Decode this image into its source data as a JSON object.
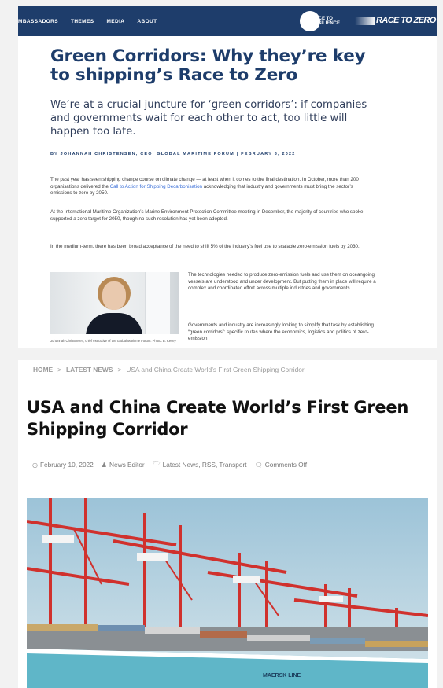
{
  "top_article": {
    "nav": {
      "items": [
        "MBASSADORS",
        "THEMES",
        "MEDIA",
        "ABOUT"
      ],
      "logo_left": {
        "line1": "RACE TO",
        "line2": "RESILIENCE"
      },
      "logo_right": "RACE TO ZERO"
    },
    "title": "Green Corridors: Why they’re key to shipping’s Race to Zero",
    "subtitle": "We’re at a crucial juncture for ‘green corridors’: if companies and governments wait for each other to act, too little will happen too late.",
    "byline": "BY JOHANNAH CHRISTENSEN, CEO, GLOBAL MARITIME FORUM | FEBRUARY 3, 2022",
    "para1": {
      "before": "The past year has seen shipping change course on climate change — at least when it comes to the final destination. In October, more than 200 organisations delivered the ",
      "link": "Call to Action for Shipping Decarbonisation",
      "after": " acknowledging that industry and governments must bring the sector’s emissions to zero by 2050."
    },
    "para2": "At the International Maritime Organization’s Marine Environment Protection Committee meeting in December, the majority of countries who spoke supported a zero target for 2050, though no such resolution has yet been adopted.",
    "para3": "In the medium-term, there has been broad acceptance of the need to shift 5% of the industry’s fuel use to scalable zero-emission fuels by 2030.",
    "para4": "The technologies needed to produce zero-emission fuels and use them on oceangoing vessels are understood and under development. But putting them in place will require a complex and coordinated effort across multiple industries and governments.",
    "para5": "Governments and industry are increasingly looking to simplify that task by establishing “green corridors”: specific routes where the economics, logistics and politics of zero-emission",
    "photo_caption": "Johannah Christensen, chief executive of the Global Maritime Forum. Photo: B. Kesey"
  },
  "bottom_article": {
    "breadcrumbs": [
      "HOME",
      "LATEST NEWS",
      "USA and China Create World’s First Green Shipping Corridor"
    ],
    "breadcrumb_sep": ">",
    "title": "USA and China Create World’s First Green Shipping Corridor",
    "meta": {
      "date": "February 10, 2022",
      "author": "News Editor",
      "categories": "Latest News, RSS, Transport",
      "comments": "Comments Off"
    },
    "hero_ship_name": "MAERSK LINE"
  },
  "colors": {
    "navy": "#1e3d6b",
    "link": "#3a6fd8",
    "hull": "#5fb6c8",
    "crane_red": "#d0312d"
  }
}
